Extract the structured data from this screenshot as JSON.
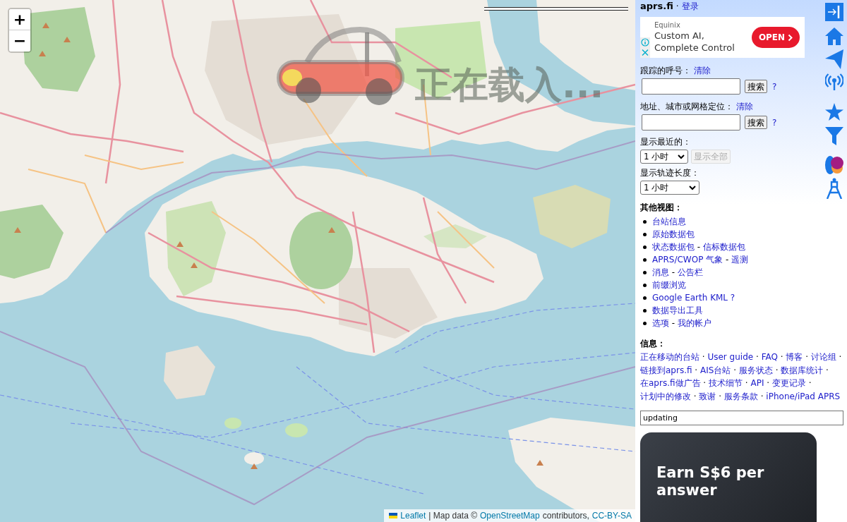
{
  "map": {
    "zoom_in": "+",
    "zoom_out": "−",
    "loading_text": "正在载入...",
    "attribution": [
      {
        "kind": "link",
        "text": "Leaflet"
      },
      {
        "kind": "text",
        "text": "| Map data ©"
      },
      {
        "kind": "link",
        "text": "OpenStreetMap"
      },
      {
        "kind": "text",
        "text": "contributors,"
      },
      {
        "kind": "link",
        "text": "CC-BY-SA"
      }
    ]
  },
  "sidebar": {
    "site": "aprs.fi",
    "separator": "·",
    "login": "登录",
    "ad": {
      "advertiser": "Equinix",
      "headline": "Custom AI, Complete Control",
      "button": "OPEN"
    },
    "searches": [
      {
        "label": "跟踪的呼号：",
        "clear": "清除",
        "button": "搜索",
        "help": "?"
      },
      {
        "label": "地址、城市或网格定位：",
        "clear": "清除",
        "button": "搜索",
        "help": "?"
      }
    ],
    "show_recent": {
      "label": "显示最近的：",
      "value": "1 小时",
      "button": {
        "label": "显示全部",
        "disabled": true
      }
    },
    "track_length": {
      "label": "显示轨迹长度：",
      "value": "1 小时"
    },
    "other_views": {
      "title": "其他视图：",
      "separator": "-",
      "items": [
        [
          "台站信息"
        ],
        [
          "原始数据包"
        ],
        [
          "状态数据包",
          "信标数据包"
        ],
        [
          "APRS/CWOP 气象",
          "遥测"
        ],
        [
          "消息",
          "公告栏"
        ],
        [
          "前缀浏览"
        ],
        [
          "Google Earth KML ?"
        ],
        [
          "数据导出工具"
        ],
        [
          "选项",
          "我的帐户"
        ]
      ]
    },
    "info": {
      "title": "信息：",
      "separator": "·",
      "links": [
        "正在移动的台站",
        "User guide",
        "FAQ",
        "博客",
        "讨论组",
        "链接到aprs.fi",
        "AIS台站",
        "服务状态",
        "数据库统计",
        "在aprs.fi做广告",
        "技术细节",
        "API",
        "变更记录",
        "计划中的修改",
        "致谢",
        "服务条款",
        "iPhone/iPad APRS"
      ]
    },
    "status": {
      "value": "updating"
    },
    "promo": {
      "text": "Earn S$6 per answer"
    }
  }
}
